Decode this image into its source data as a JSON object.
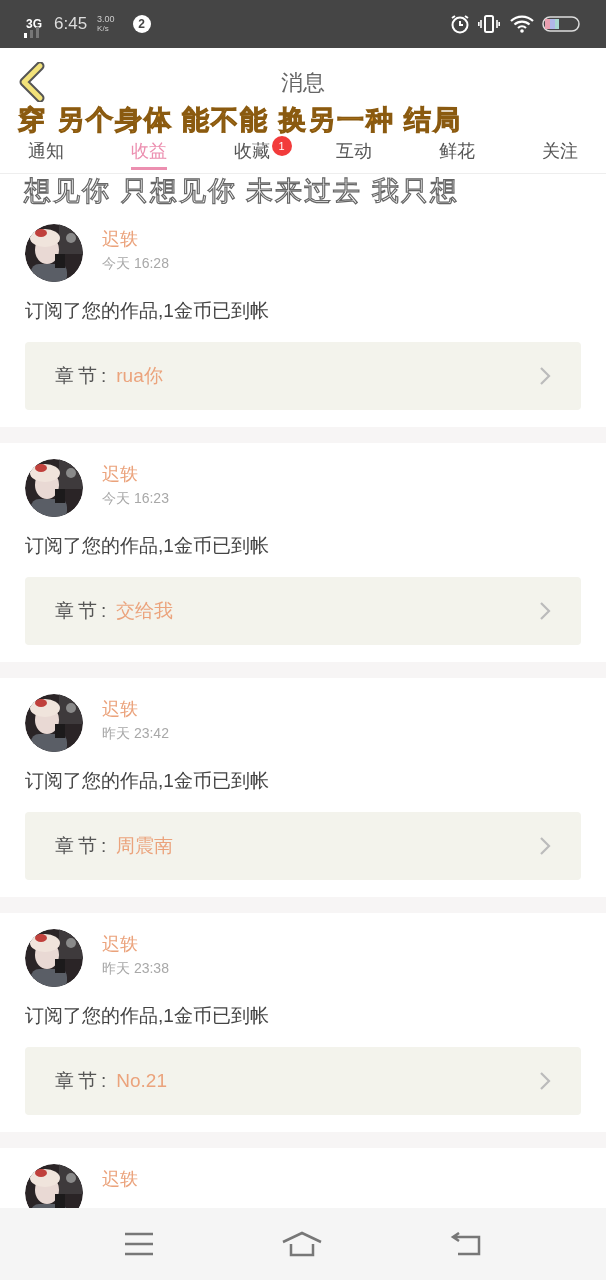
{
  "status_bar": {
    "network": "3G",
    "time": "6:45",
    "speed_value": "3.00",
    "speed_unit": "K/s",
    "notification_count": "2"
  },
  "header": {
    "title": "消息"
  },
  "tabs": [
    {
      "label": "通知",
      "selected": false
    },
    {
      "label": "收益",
      "selected": true
    },
    {
      "label": "收藏",
      "selected": false,
      "badge": "1"
    },
    {
      "label": "互动",
      "selected": false
    },
    {
      "label": "鲜花",
      "selected": false
    },
    {
      "label": "关注",
      "selected": false
    }
  ],
  "messages": [
    {
      "name": "迟轶",
      "time": "今天 16:28",
      "text": "订阅了您的作品,1金币已到帐",
      "chapter_label": "章节:",
      "chapter": "rua你"
    },
    {
      "name": "迟轶",
      "time": "今天 16:23",
      "text": "订阅了您的作品,1金币已到帐",
      "chapter_label": "章节:",
      "chapter": "交给我"
    },
    {
      "name": "迟轶",
      "time": "昨天 23:42",
      "text": "订阅了您的作品,1金币已到帐",
      "chapter_label": "章节:",
      "chapter": "周震南"
    },
    {
      "name": "迟轶",
      "time": "昨天 23:38",
      "text": "订阅了您的作品,1金币已到帐",
      "chapter_label": "章节:",
      "chapter": "No.21"
    },
    {
      "name": "迟轶"
    }
  ],
  "lyrics": [
    "穿 另个身体 能不能 换另一种 结局",
    "想见你 只想见你 未来过去 我只想"
  ]
}
